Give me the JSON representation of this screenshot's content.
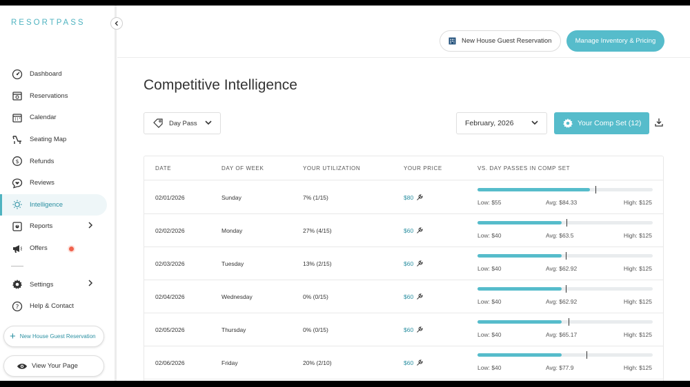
{
  "brand": {
    "logo": "RESORTPASS",
    "accent": "#56bccb",
    "alert": "#f0624d"
  },
  "sidebar": {
    "items": [
      {
        "label": "Dashboard",
        "icon": "speedometer-icon",
        "active": false
      },
      {
        "label": "Reservations",
        "icon": "calendar-check-icon",
        "active": false
      },
      {
        "label": "Calendar",
        "icon": "calendar-icon",
        "active": false
      },
      {
        "label": "Seating Map",
        "icon": "lounge-chair-icon",
        "active": false
      },
      {
        "label": "Refunds",
        "icon": "refund-icon",
        "active": false
      },
      {
        "label": "Reviews",
        "icon": "chat-heart-icon",
        "active": false
      },
      {
        "label": "Intelligence",
        "icon": "lightbulb-icon",
        "active": true
      },
      {
        "label": "Reports",
        "icon": "reports-icon",
        "active": false,
        "chevron": true
      },
      {
        "label": "Offers",
        "icon": "megaphone-icon",
        "active": false,
        "badge": true
      }
    ],
    "bottom_items": [
      {
        "label": "Settings",
        "icon": "gear-icon",
        "chevron": true
      },
      {
        "label": "Help & Contact",
        "icon": "question-icon"
      }
    ],
    "new_reservation_label": "New House Guest Reservation",
    "view_page_label": "View Your Page"
  },
  "topbar": {
    "new_reservation_label": "New House Guest Reservation",
    "manage_label": "Manage Inventory & Pricing"
  },
  "page": {
    "title": "Competitive Intelligence",
    "product_filter": "Day Pass",
    "month_filter": "February, 2026",
    "comp_set_label": "Your Comp Set (12)"
  },
  "table": {
    "headers": [
      "DATE",
      "DAY OF WEEK",
      "YOUR UTILIZATION",
      "YOUR PRICE",
      "VS. DAY PASSES IN COMP SET"
    ],
    "rows": [
      {
        "date": "02/01/2026",
        "day": "Sunday",
        "utilization": "7% (1/15)",
        "price": "$80",
        "low": "Low: $55",
        "avg": "Avg: $84.33",
        "high": "High: $125",
        "price_val": 80,
        "low_val": 55,
        "avg_val": 84.33,
        "high_val": 125
      },
      {
        "date": "02/02/2026",
        "day": "Monday",
        "utilization": "27% (4/15)",
        "price": "$60",
        "low": "Low: $40",
        "avg": "Avg: $63.5",
        "high": "High: $125",
        "price_val": 60,
        "low_val": 40,
        "avg_val": 63.5,
        "high_val": 125
      },
      {
        "date": "02/03/2026",
        "day": "Tuesday",
        "utilization": "13% (2/15)",
        "price": "$60",
        "low": "Low: $40",
        "avg": "Avg: $62.92",
        "high": "High: $125",
        "price_val": 60,
        "low_val": 40,
        "avg_val": 62.92,
        "high_val": 125
      },
      {
        "date": "02/04/2026",
        "day": "Wednesday",
        "utilization": "0% (0/15)",
        "price": "$60",
        "low": "Low: $40",
        "avg": "Avg: $62.92",
        "high": "High: $125",
        "price_val": 60,
        "low_val": 40,
        "avg_val": 62.92,
        "high_val": 125
      },
      {
        "date": "02/05/2026",
        "day": "Thursday",
        "utilization": "0% (0/15)",
        "price": "$60",
        "low": "Low: $40",
        "avg": "Avg: $65.17",
        "high": "High: $125",
        "price_val": 60,
        "low_val": 40,
        "avg_val": 65.17,
        "high_val": 125
      },
      {
        "date": "02/06/2026",
        "day": "Friday",
        "utilization": "20% (2/10)",
        "price": "$60",
        "low": "Low: $40",
        "avg": "Avg: $77.9",
        "high": "High: $125",
        "price_val": 60,
        "low_val": 40,
        "avg_val": 77.9,
        "high_val": 125
      }
    ]
  }
}
